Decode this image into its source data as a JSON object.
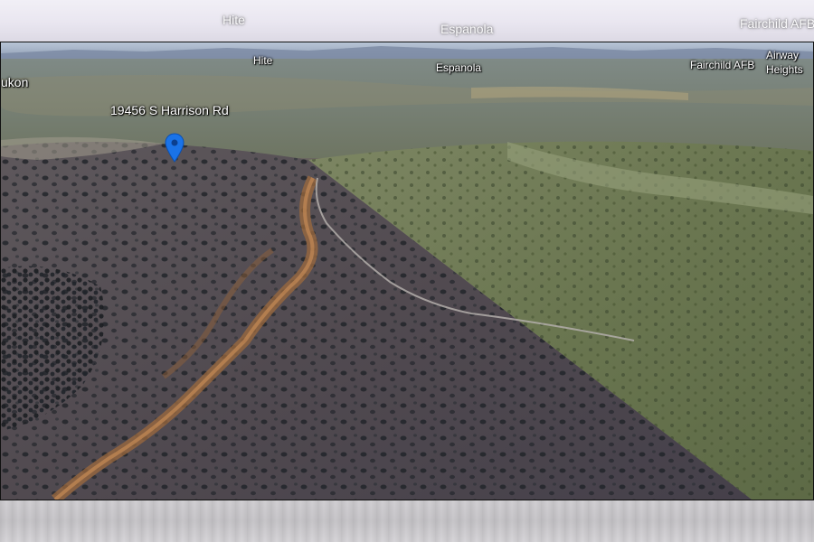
{
  "top_echo_labels": {
    "hite": "Hite",
    "espanola": "Espanola",
    "fairchild": "Fairchild AFB"
  },
  "map": {
    "place_labels": {
      "yukon": "ukon",
      "hite": "Hite",
      "espanola": "Espanola",
      "fairchild": "Fairchild AFB",
      "airway_heights_line1": "Airway",
      "airway_heights_line2": "Heights"
    },
    "pin_label": "19456 S Harrison Rd",
    "pin_icon": "map-pin-icon",
    "pin_color": "#1a73e8"
  },
  "colors": {
    "terrain_dark": "#5a5558",
    "terrain_green": "#6f7a55",
    "sky": "#9fb2c8",
    "creek": "#9c6a3e"
  }
}
